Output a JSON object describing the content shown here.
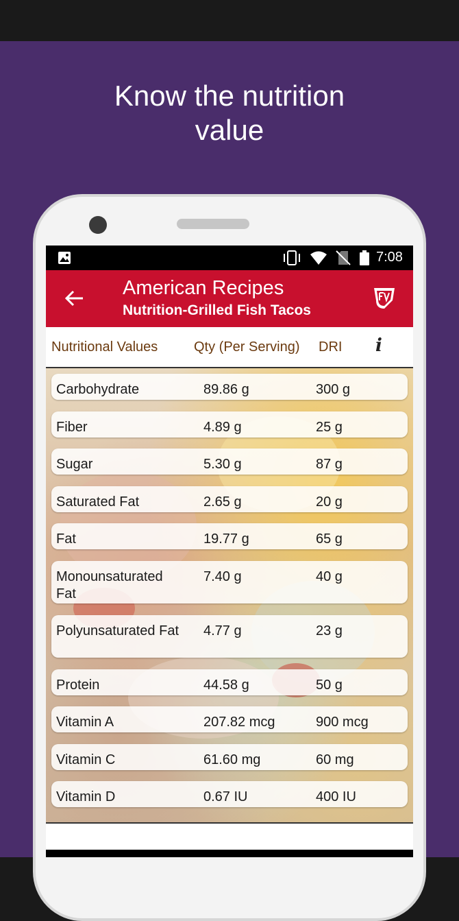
{
  "promo": {
    "headline_line1": "Know the nutrition",
    "headline_line2": "value"
  },
  "status_bar": {
    "time": "7:08",
    "icons": [
      "image-icon",
      "vibrate-icon",
      "wifi-icon",
      "no-sim-icon",
      "battery-icon"
    ]
  },
  "app_bar": {
    "title": "American Recipes",
    "subtitle": "Nutrition-Grilled Fish Tacos",
    "back_icon": "arrow-left-icon",
    "logo_icon": "fv-logo-icon"
  },
  "table": {
    "headers": {
      "name": "Nutritional Values",
      "qty": "Qty (Per Serving)",
      "dri": "DRI",
      "info_icon": "i"
    },
    "rows": [
      {
        "name": "Carbohydrate",
        "qty": "89.86 g",
        "dri": "300 g"
      },
      {
        "name": "Fiber",
        "qty": "4.89 g",
        "dri": "25 g"
      },
      {
        "name": "Sugar",
        "qty": "5.30 g",
        "dri": "87 g"
      },
      {
        "name": "Saturated Fat",
        "qty": "2.65 g",
        "dri": "20 g"
      },
      {
        "name": "Fat",
        "qty": "19.77 g",
        "dri": "65 g"
      },
      {
        "name": "Monounsaturated Fat",
        "qty": "7.40 g",
        "dri": "40 g"
      },
      {
        "name": "Polyunsaturated Fat",
        "qty": "4.77 g",
        "dri": "23 g"
      },
      {
        "name": "Protein",
        "qty": "44.58 g",
        "dri": "50 g"
      },
      {
        "name": "Vitamin A",
        "qty": "207.82 mcg",
        "dri": "900 mcg"
      },
      {
        "name": "Vitamin C",
        "qty": "61.60 mg",
        "dri": "60 mg"
      },
      {
        "name": "Vitamin D",
        "qty": "0.67 IU",
        "dri": "400 IU"
      }
    ]
  },
  "colors": {
    "promo_bg": "#4a2d6b",
    "app_bar": "#c8102e",
    "header_text": "#6b3a0f"
  }
}
